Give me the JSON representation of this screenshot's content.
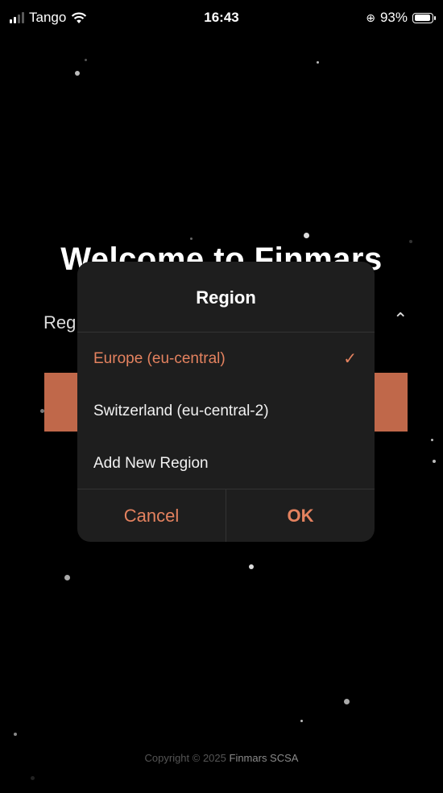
{
  "status_bar": {
    "carrier": "Tango",
    "time": "16:43",
    "battery_percent": "93%",
    "battery_level": 0.93
  },
  "background": {
    "title": "Welcome to Finmars",
    "region_label": "Reg",
    "region_value_tail": ")"
  },
  "dialog": {
    "title": "Region",
    "options": [
      {
        "label": "Europe (eu-central)",
        "selected": true
      },
      {
        "label": "Switzerland (eu-central-2)",
        "selected": false
      },
      {
        "label": "Add New Region",
        "selected": false
      }
    ],
    "cancel_label": "Cancel",
    "ok_label": "OK"
  },
  "footer": {
    "copyright_prefix": "Copyright © 2025",
    "company": "Finmars SCSA"
  },
  "colors": {
    "accent": "#e4825f",
    "button": "#c0684a",
    "dialog_bg": "#1e1e1e"
  }
}
